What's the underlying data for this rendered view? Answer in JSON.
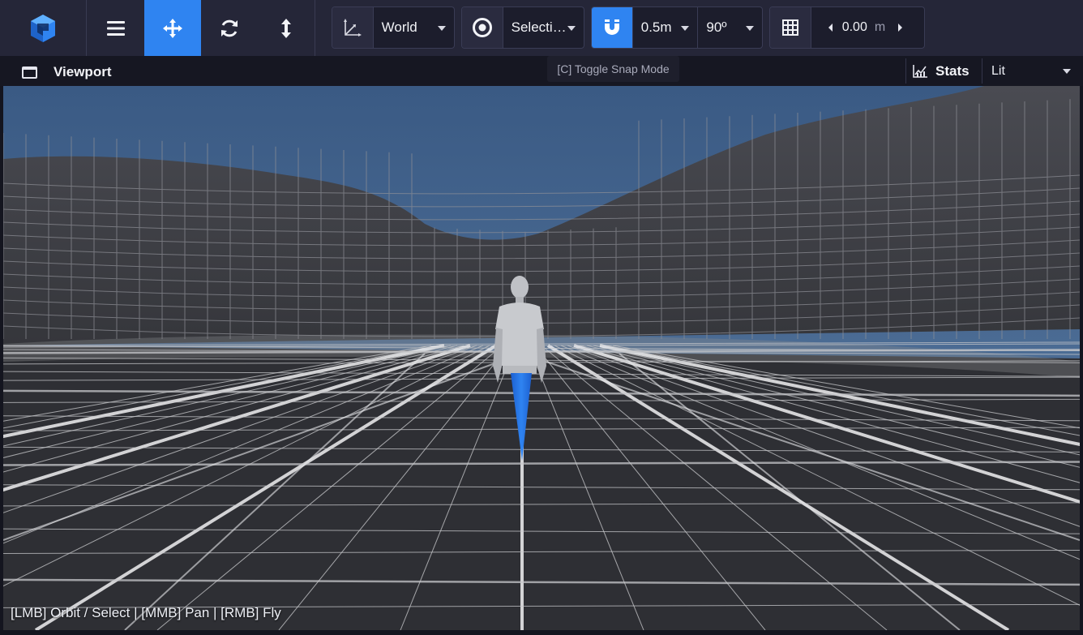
{
  "toolbar": {
    "coordinate_space": "World",
    "selection_mode": "Selecti…",
    "snap_distance": "0.5m",
    "snap_angle": "90º",
    "grid_offset_value": "0.00",
    "grid_offset_unit": "m",
    "active_tool": "move"
  },
  "tooltip": {
    "text": "[C] Toggle Snap Mode"
  },
  "viewport": {
    "title": "Viewport",
    "stats_label": "Stats",
    "render_mode": "Lit",
    "controls_hint": "[LMB] Orbit / Select | [MMB] Pan | [RMB] Fly"
  },
  "colors": {
    "accent": "#2f84f1",
    "toolbar_bg": "#252638",
    "sky_top": "#3a5b83",
    "ground": "#2d2e33"
  },
  "icons": {
    "logo": "engine-logo-icon",
    "menu": "hamburger-menu-icon",
    "move": "move-arrows-icon",
    "rotate": "rotate-icon",
    "scale": "vertical-resize-icon",
    "axes": "axes-icon",
    "target": "target-icon",
    "magnet": "magnet-icon",
    "grid": "grid-icon"
  }
}
